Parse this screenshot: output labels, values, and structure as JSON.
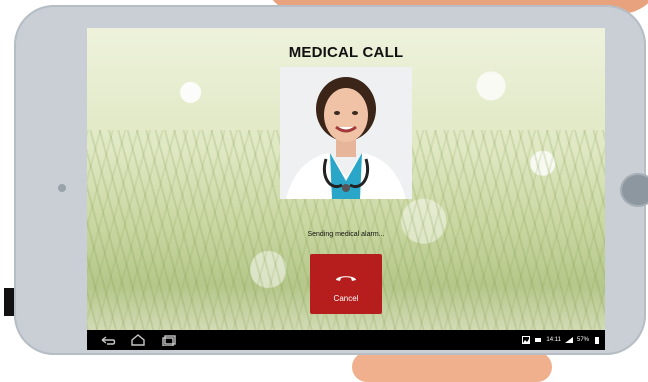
{
  "call": {
    "title": "MEDICAL CALL",
    "status": "Sending medical alarm...",
    "cancel_label": "Cancel"
  },
  "status_bar": {
    "time": "14:11",
    "battery": "57%"
  },
  "icons": {
    "back": "back-icon",
    "home": "home-icon",
    "recents": "recents-icon",
    "gallery": "image-icon",
    "notification": "notification-icon",
    "wifi": "wifi-icon",
    "battery": "battery-icon",
    "hangup": "phone-hangup-icon"
  },
  "colors": {
    "cancel_bg": "#b61d1d",
    "nav_bg": "#000000",
    "tablet_frame": "#c9cfd5"
  }
}
